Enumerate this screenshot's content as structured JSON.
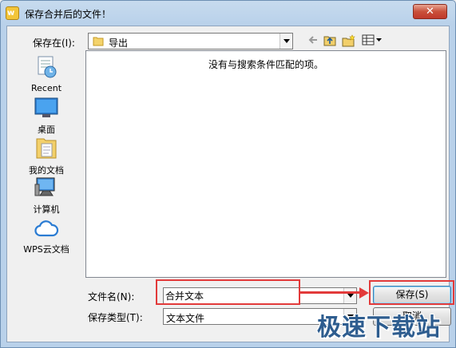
{
  "window": {
    "title": "保存合并后的文件！",
    "close_symbol": "✕",
    "app_icon_glyph": "w"
  },
  "toolbar": {
    "save_in_label": "保存在(I):",
    "location": "导出",
    "icons": [
      "back-arrow-icon",
      "up-folder-icon",
      "new-folder-icon",
      "view-menu-icon"
    ]
  },
  "places": [
    {
      "label": "Recent",
      "icon": "recent-icon"
    },
    {
      "label": "桌面",
      "icon": "desktop-icon"
    },
    {
      "label": "我的文档",
      "icon": "documents-icon"
    },
    {
      "label": "计算机",
      "icon": "computer-icon"
    },
    {
      "label": "WPS云文档",
      "icon": "cloud-icon"
    }
  ],
  "file_list": {
    "empty_message": "没有与搜索条件匹配的项。"
  },
  "form": {
    "filename_label": "文件名(N):",
    "filename_value": "合并文本",
    "filetype_label": "保存类型(T):",
    "filetype_value": "文本文件"
  },
  "buttons": {
    "save": "保存(S)",
    "cancel": "取消"
  },
  "watermark": "极速下载站",
  "colors": {
    "annotation_red": "#e23a3a",
    "frame_blue": "#b9d1ea",
    "close_red": "#c0392b"
  }
}
